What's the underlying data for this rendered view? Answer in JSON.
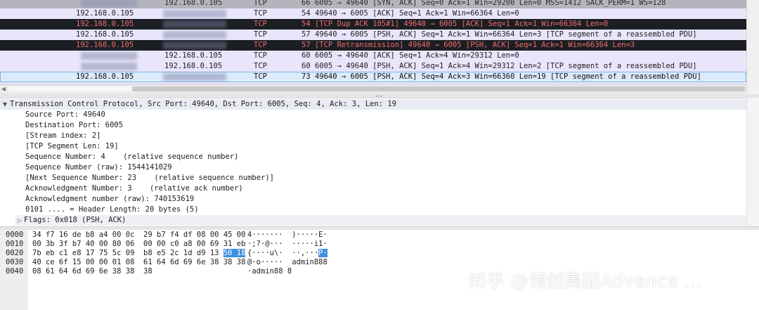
{
  "packet_list": {
    "rows": [
      {
        "src": "",
        "dst": "192.168.0.105",
        "proto": "TCP",
        "info": "66 6005 → 49640 [SYN, ACK] Seq=0 Ack=1 Win=29200 Len=0 MSS=1412 SACK_PERM=1 WS=128",
        "style": "row-top"
      },
      {
        "src": "192.168.0.105",
        "dst": "",
        "proto": "TCP",
        "info": "54 49640 → 6005 [ACK] Seq=1 Ack=1 Win=66364 Len=0",
        "style": "row-normal"
      },
      {
        "src": "192.168.0.105",
        "dst": "",
        "proto": "TCP",
        "info": "54 [TCP Dup ACK 105#1] 49640 → 6005 [ACK] Seq=1 Ack=1 Win=66364 Len=0",
        "style": "row-dark"
      },
      {
        "src": "192.168.0.105",
        "dst": "",
        "proto": "TCP",
        "info": "57 49640 → 6005 [PSH, ACK] Seq=1 Ack=1 Win=66364 Len=3 [TCP segment of a reassembled PDU]",
        "style": "row-normal"
      },
      {
        "src": "192.168.0.105",
        "dst": "",
        "proto": "TCP",
        "info": "57 [TCP Retransmission] 49640 → 6005 [PSH, ACK] Seq=1 Ack=1 Win=66364 Len=3",
        "style": "row-dark"
      },
      {
        "src": "",
        "dst": "192.168.0.105",
        "proto": "TCP",
        "info": "60 6005 → 49640 [ACK] Seq=1 Ack=4 Win=29312 Len=0",
        "style": "row-normal"
      },
      {
        "src": "",
        "dst": "192.168.0.105",
        "proto": "TCP",
        "info": "60 6005 → 49640 [PSH, ACK] Seq=1 Ack=4 Win=29312 Len=2 [TCP segment of a reassembled PDU]",
        "style": "row-normal"
      },
      {
        "src": "192.168.0.105",
        "dst": "",
        "proto": "TCP",
        "info": "73 49640 → 6005 [PSH, ACK] Seq=4 Ack=3 Win=66360 Len=19 [TCP segment of a reassembled PDU]",
        "style": "row-sel"
      }
    ]
  },
  "details": {
    "header": "Transmission Control Protocol, Src Port: 49640, Dst Port: 6005, Seq: 4, Ack: 3, Len: 19",
    "fields": [
      "Source Port: 49640",
      "Destination Port: 6005",
      "[Stream index: 2]",
      "[TCP Segment Len: 19]",
      "Sequence Number: 4    (relative sequence number)",
      "Sequence Number (raw): 1544141029",
      "[Next Sequence Number: 23    (relative sequence number)]",
      "Acknowledgment Number: 3    (relative ack number)",
      "Acknowledgment number (raw): 740153619",
      "0101 .... = Header Length: 20 bytes (5)"
    ],
    "flags": "Flags: 0x018 (PSH, ACK)"
  },
  "bytes": {
    "rows": [
      {
        "offset": "0000",
        "hex": "34 f7 16 de b8 a4 00 0c  29 b7 f4 df 08 00 45 00",
        "hex_hl": "",
        "ascii": "4·······  )·····E·",
        "ascii_hl": ""
      },
      {
        "offset": "0010",
        "hex": "00 3b 3f b7 40 00 80 06  00 00 c0 a8 00 69 31 eb",
        "hex_hl": "",
        "ascii": "·;?·@···  ·····i1·",
        "ascii_hl": ""
      },
      {
        "offset": "0020",
        "hex": "7b eb c1 e8 17 75 5c 09  b8 e5 2c 1d d9 13 ",
        "hex_hl": "50 18",
        "ascii": "{····u\\·  ··,···",
        "ascii_hl": "P·"
      },
      {
        "offset": "0030",
        "hex": "40 ce 6f 15 00 00 01 08  61 64 6d 69 6e 38 38 38",
        "hex_hl": "",
        "ascii": "@·o·····  admin888",
        "ascii_hl": ""
      },
      {
        "offset": "0040",
        "hex": "08 61 64 6d 69 6e 38 38  38",
        "hex_hl": "",
        "ascii": "·admin88 8",
        "ascii_hl": ""
      }
    ]
  },
  "watermark": "知乎 @领创集团Advance ...",
  "icons": {
    "expand": "triangle-down",
    "collapsed": "triangle-right"
  }
}
